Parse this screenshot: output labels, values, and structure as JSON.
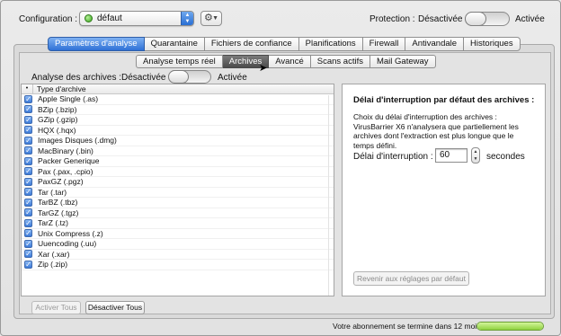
{
  "topbar": {
    "config_label": "Configuration :",
    "config_value": "défaut",
    "protection_label": "Protection :",
    "protection_off": "Désactivée",
    "protection_on": "Activée"
  },
  "main_tabs": [
    {
      "label": "Paramètres d'analyse",
      "active": true
    },
    {
      "label": "Quarantaine",
      "active": false
    },
    {
      "label": "Fichiers de confiance",
      "active": false
    },
    {
      "label": "Planifications",
      "active": false
    },
    {
      "label": "Firewall",
      "active": false
    },
    {
      "label": "Antivandale",
      "active": false
    },
    {
      "label": "Historiques",
      "active": false
    }
  ],
  "sub_tabs": [
    {
      "label": "Analyse temps réel",
      "active": false
    },
    {
      "label": "Archives",
      "active": true
    },
    {
      "label": "Avancé",
      "active": false
    },
    {
      "label": "Scans actifs",
      "active": false
    },
    {
      "label": "Mail Gateway",
      "active": false
    }
  ],
  "archive_scan": {
    "label": "Analyse des archives :",
    "off": "Désactivée",
    "on": "Activée"
  },
  "archive_list": {
    "header_check": "•",
    "header_name": "Type d'archive",
    "items": [
      "Apple Single (.as)",
      "BZip (.bzip)",
      "GZip (.gzip)",
      "HQX (.hqx)",
      "Images Disques (.dmg)",
      "MacBinary (.bin)",
      "Packer Generique",
      "Pax (.pax, .cpio)",
      "PaxGZ (.pgz)",
      "Tar (.tar)",
      "TarBZ (.tbz)",
      "TarGZ (.tgz)",
      "TarZ (.tz)",
      "Unix Compress (.z)",
      "Uuencoding (.uu)",
      "Xar (.xar)",
      "Zip (.zip)"
    ]
  },
  "right_panel": {
    "title": "Délai d'interruption par défaut des archives :",
    "description": "Choix du délai d'interruption des archives : VirusBarrier X6 n'analysera que partiellement les archives dont l'extraction est plus longue que le temps défini.",
    "delay_label": "Délai d'interruption :",
    "delay_value": "60",
    "delay_unit": "secondes",
    "reset_label": "Revenir aux réglages par défaut"
  },
  "buttons": {
    "enable_all": "Activer Tous",
    "disable_all": "Désactiver Tous"
  },
  "footer": {
    "subscription_text": "Votre abonnement se termine dans 12 mois"
  },
  "colors": {
    "active_tab": "#2f71d6",
    "status_green": "#3aa51c",
    "progress_green": "#8fd23e"
  }
}
